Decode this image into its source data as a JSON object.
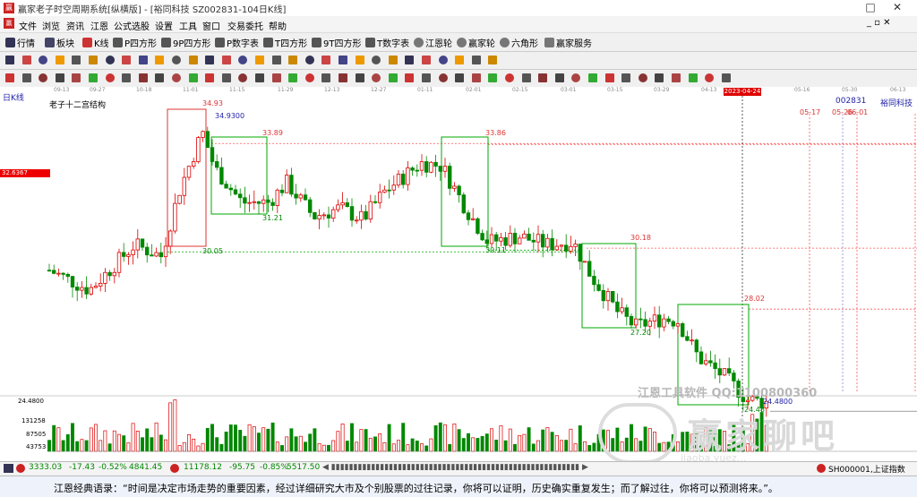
{
  "window": {
    "title": "赢家老子时空周期系统[纵横版] - [裕同科技 SZ002831-104日K线]",
    "minimize": "_",
    "maximize": "□",
    "close": "✕"
  },
  "menu": [
    "文件",
    "浏览",
    "资讯",
    "江恩",
    "公式选股",
    "设置",
    "工具",
    "窗口",
    "交易委托",
    "帮助"
  ],
  "toolbar": {
    "buttons": [
      "行情",
      "板块",
      "K线",
      "P四方形",
      "9P四方形",
      "P数字表",
      "T四方形",
      "9T四方形",
      "T数字表",
      "江恩轮",
      "赢家轮",
      "六角形",
      "赢家服务"
    ]
  },
  "chart": {
    "period_label": "日K线",
    "indicator_title": "老子十二宫结构",
    "stock_code": "002831",
    "stock_name": "裕同科技",
    "current_date": "2023-04-24",
    "price_marker": "32.6367",
    "date_ticks": [
      "09-13",
      "09-27",
      "10-18",
      "11-01",
      "11-15",
      "11-29",
      "12-13",
      "12-27",
      "01-11",
      "02-01",
      "02-15",
      "03-01",
      "03-15",
      "03-29",
      "04-13",
      "05-16",
      "05-30",
      "06-13"
    ],
    "future_dates": [
      "05-17",
      "05-26",
      "06-01"
    ],
    "levels": {
      "high1": "34.93",
      "high1_exact": "34.9300",
      "top2": "33.89",
      "bottom2": "31.21",
      "bottom1": "30.05",
      "top3": "33.86",
      "bottom3": "30.11",
      "top4": "30.18",
      "bottom4": "27.20",
      "top5": "28.02",
      "bottom5": "24.48",
      "low_exact": "24.4800"
    },
    "volume_ticks": [
      "24.4800",
      "131258",
      "87505",
      "43753"
    ],
    "watermark_top": "江恩工具软件  QQ:1100800360",
    "watermark_main": "赢家聊吧",
    "watermark_sub": "jiaoba.yuez..."
  },
  "statusbar": {
    "sh_index": "3333.03",
    "sh_change": "-17.43",
    "sh_pct": "-0.52%",
    "sh_vol": "4841.45",
    "sz_index": "11178.12",
    "sz_change": "-95.75",
    "sz_pct": "-0.85%",
    "sz_vol": "5517.50",
    "right_label": "SH000001,上证指数"
  },
  "quote": "江恩经典语录：“时间是决定市场走势的重要因素，经过详细研究大市及个别股票的过往记录，你将可以证明，历史确实重复发生；而了解过往，你将可以预测将来。”。",
  "colors": {
    "up": "#d00000",
    "down": "#008800",
    "grid": "#ff6666",
    "box": "#009900"
  }
}
